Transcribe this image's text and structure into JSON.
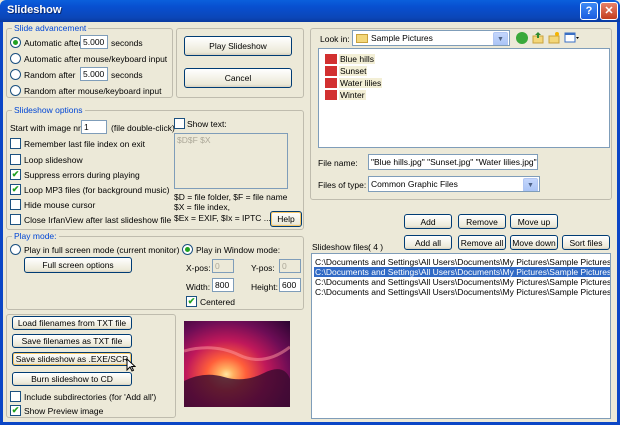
{
  "window": {
    "title": "Slideshow",
    "help_glyph": "?",
    "close_glyph": "✕"
  },
  "slide_advancement": {
    "legend": "Slide advancement",
    "auto_after_label": "Automatic after",
    "auto_after_value": "5.000",
    "auto_seconds": "seconds",
    "auto_mouse_label": "Automatic after mouse/keyboard input",
    "random_after_label": "Random   after",
    "random_after_value": "5.000",
    "random_seconds": "seconds",
    "random_mouse_label": "Random   after mouse/keyboard input"
  },
  "buttons": {
    "play": "Play Slideshow",
    "cancel": "Cancel",
    "help": "Help",
    "full_screen_options": "Full screen options",
    "load_txt": "Load filenames from TXT file",
    "save_txt": "Save filenames as TXT file",
    "save_exe": "Save slideshow as .EXE/SCR",
    "burn_cd": "Burn slideshow to CD",
    "add": "Add",
    "remove": "Remove",
    "move_up": "Move up",
    "add_all": "Add all",
    "remove_all": "Remove all",
    "move_down": "Move down",
    "sort_files": "Sort files"
  },
  "slideshow_options": {
    "legend": "Slideshow options",
    "start_label": "Start with image nr.:",
    "start_value": "1",
    "start_hint": "(file double-click)",
    "remember_label": "Remember last file index on exit",
    "loop_label": "Loop slideshow",
    "suppress_label": "Suppress errors during playing",
    "loop_mp3_label": "Loop MP3 files (for background music)",
    "hide_cursor_label": "Hide mouse cursor",
    "close_label": "Close IrfanView after last slideshow file",
    "show_text_label": "Show text:",
    "show_text_value": "$D$F $X",
    "text_help_1": "$D = file folder, $F = file name",
    "text_help_2": "$X = file index,",
    "text_help_3": "$Ex = EXIF, $Ix = IPTC ..."
  },
  "play_mode": {
    "legend": "Play mode:",
    "full_screen_label": "Play in full screen mode (current monitor)",
    "window_mode_label": "Play in Window mode:",
    "xpos_label": "X-pos:",
    "xpos_value": "0",
    "ypos_label": "Y-pos:",
    "ypos_value": "0",
    "width_label": "Width:",
    "width_value": "800",
    "height_label": "Height:",
    "height_value": "600",
    "centered_label": "Centered"
  },
  "bottom_options": {
    "subdirs_label": "Include subdirectories (for 'Add all')",
    "show_preview_label": "Show Preview image"
  },
  "browser": {
    "look_in_label": "Look in:",
    "look_in_value": "Sample Pictures",
    "files": [
      "Blue hills",
      "Sunset",
      "Water lilies",
      "Winter"
    ],
    "file_name_label": "File name:",
    "file_name_value": "\"Blue hills.jpg\" \"Sunset.jpg\" \"Water lilies.jpg\" \"",
    "files_of_type_label": "Files of type:",
    "files_of_type_value": "Common Graphic Files"
  },
  "slideshow_files": {
    "label": "Slideshow files:",
    "count": "( 4 )",
    "items": [
      "C:\\Documents and Settings\\All Users\\Documents\\My Pictures\\Sample Pictures\\Blue",
      "C:\\Documents and Settings\\All Users\\Documents\\My Pictures\\Sample Pictures\\Suns",
      "C:\\Documents and Settings\\All Users\\Documents\\My Pictures\\Sample Pictures\\Wate",
      "C:\\Documents and Settings\\All Users\\Documents\\My Pictures\\Sample Pictures\\Winte"
    ],
    "selected_index": 1
  },
  "checkbox_glyph": "✔",
  "combo_glyph": "▼"
}
